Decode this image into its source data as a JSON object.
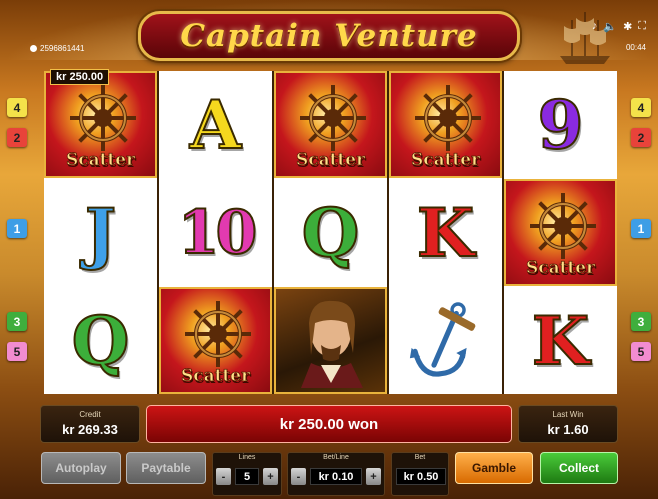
{
  "game": {
    "title": "Captain Venture",
    "balance_id_text": "2596861441",
    "clock": "00:44"
  },
  "reels": [
    [
      "scatter",
      "J",
      "Q"
    ],
    [
      "A",
      "10",
      "scatter"
    ],
    [
      "scatter",
      "Q",
      "captain"
    ],
    [
      "scatter",
      "K",
      "anchor"
    ],
    [
      "9",
      "scatter",
      "K"
    ]
  ],
  "symbol_labels": {
    "scatter": "Scatter"
  },
  "symbol_colors": {
    "A": "#f5d81e",
    "J": "#3ea0e8",
    "Q": "#3cae3a",
    "K": "#e02020",
    "10": "#e23ab0",
    "9": "#8a2ae0"
  },
  "win_badge": "kr 250.00",
  "line_markers": {
    "left": [
      "4",
      "2",
      "1",
      "3",
      "5"
    ],
    "right": [
      "4",
      "2",
      "1",
      "3",
      "5"
    ]
  },
  "credit": {
    "label": "Credit",
    "value": "kr 269.33"
  },
  "won_text": "kr 250.00 won",
  "last_win": {
    "label": "Last Win",
    "value": "kr 1.60"
  },
  "buttons": {
    "autoplay": "Autoplay",
    "paytable": "Paytable",
    "gamble": "Gamble",
    "collect": "Collect"
  },
  "lines": {
    "label": "Lines",
    "value": "5",
    "minus": "-",
    "plus": "+"
  },
  "bet_line": {
    "label": "Bet/Line",
    "value": "kr 0.10",
    "minus": "-",
    "plus": "+"
  },
  "bet": {
    "label": "Bet",
    "value": "kr 0.50"
  }
}
